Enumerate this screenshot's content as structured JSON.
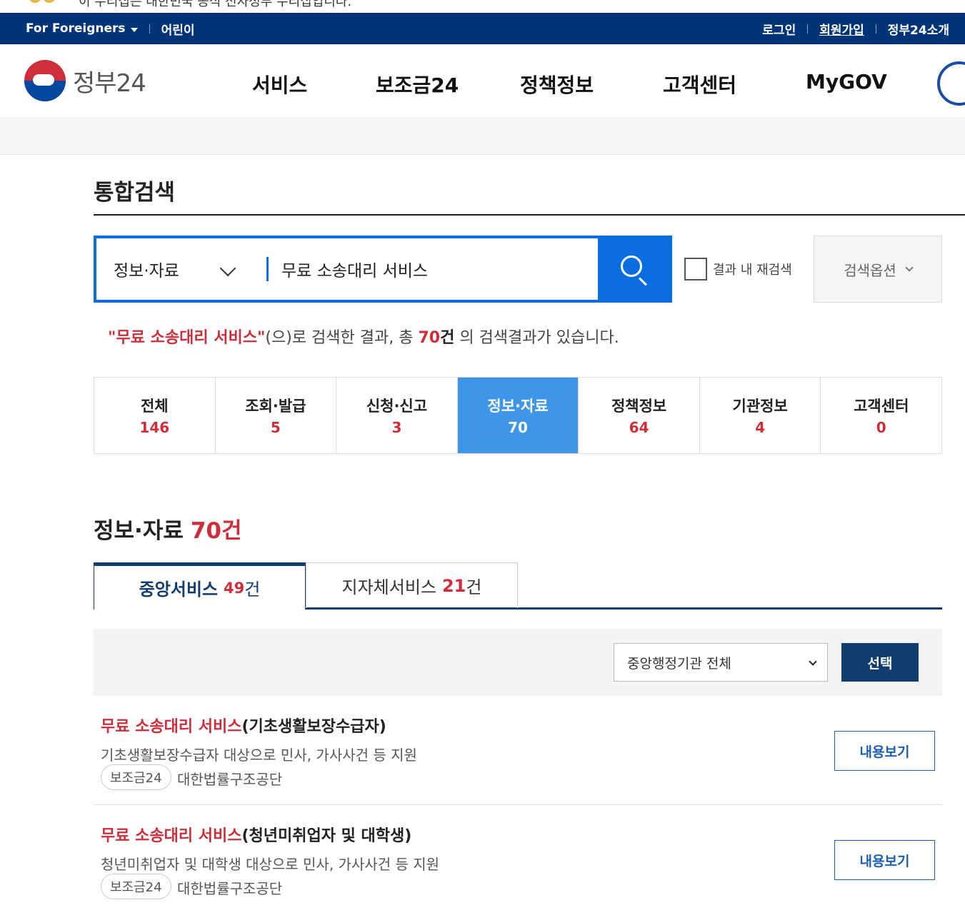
{
  "top_banner": {
    "text": "이 누리집은 대한민국 공식 전자정부 누리집입니다."
  },
  "util": {
    "foreigners": "For Foreigners",
    "kids": "어린이",
    "login": "로그인",
    "signup": "회원가입",
    "about": "정부24소개"
  },
  "header": {
    "logo_text": "정부24",
    "nav": [
      "서비스",
      "보조금24",
      "정책정보",
      "고객센터",
      "MyGOV"
    ]
  },
  "page": {
    "title": "통합검색"
  },
  "search": {
    "category": "정보·자료",
    "query": "무료 소송대리 서비스",
    "recheck_label": "결과 내 재검색",
    "options_label": "검색옵션"
  },
  "result_msg": {
    "keyword": "\"무료 소송대리 서비스\"",
    "mid": "(으)로 검색한 결과, 총 ",
    "count": "70",
    "unit": "건",
    "tail": " 의 검색결과가 있습니다."
  },
  "categories": [
    {
      "name": "전체",
      "count": "146"
    },
    {
      "name": "조회·발급",
      "count": "5"
    },
    {
      "name": "신청·신고",
      "count": "3"
    },
    {
      "name": "정보·자료",
      "count": "70"
    },
    {
      "name": "정책정보",
      "count": "64"
    },
    {
      "name": "기관정보",
      "count": "4"
    },
    {
      "name": "고객센터",
      "count": "0"
    }
  ],
  "section": {
    "title": "정보·자료",
    "count": "70",
    "unit": "건"
  },
  "subtabs": [
    {
      "label": "중앙서비스",
      "count": "49",
      "unit": "건"
    },
    {
      "label": "지자체서비스",
      "count": "21",
      "unit": "건"
    }
  ],
  "filter": {
    "select_value": "중앙행정기관 전체",
    "button": "선택"
  },
  "items": [
    {
      "title_kw": "무료 소송대리 서비스",
      "title_rest": "(기초생활보장수급자)",
      "desc": "기초생활보장수급자 대상으로 민사, 가사사건 등 지원",
      "tag": "보조금24",
      "org": "대한법률구조공단",
      "button": "내용보기"
    },
    {
      "title_kw": "무료 소송대리 서비스",
      "title_rest": "(청년미취업자 및 대학생)",
      "desc": "청년미취업자 및 대학생 대상으로 민사, 가사사건 등 지원",
      "tag": "보조금24",
      "org": "대한법률구조공단",
      "button": "내용보기"
    }
  ],
  "colors": {
    "util_bg": "#003478",
    "accent_blue": "#0a6ee0",
    "active_tab": "#3d96e8",
    "highlight_red": "#cd2e3a",
    "navy": "#103c6e"
  }
}
